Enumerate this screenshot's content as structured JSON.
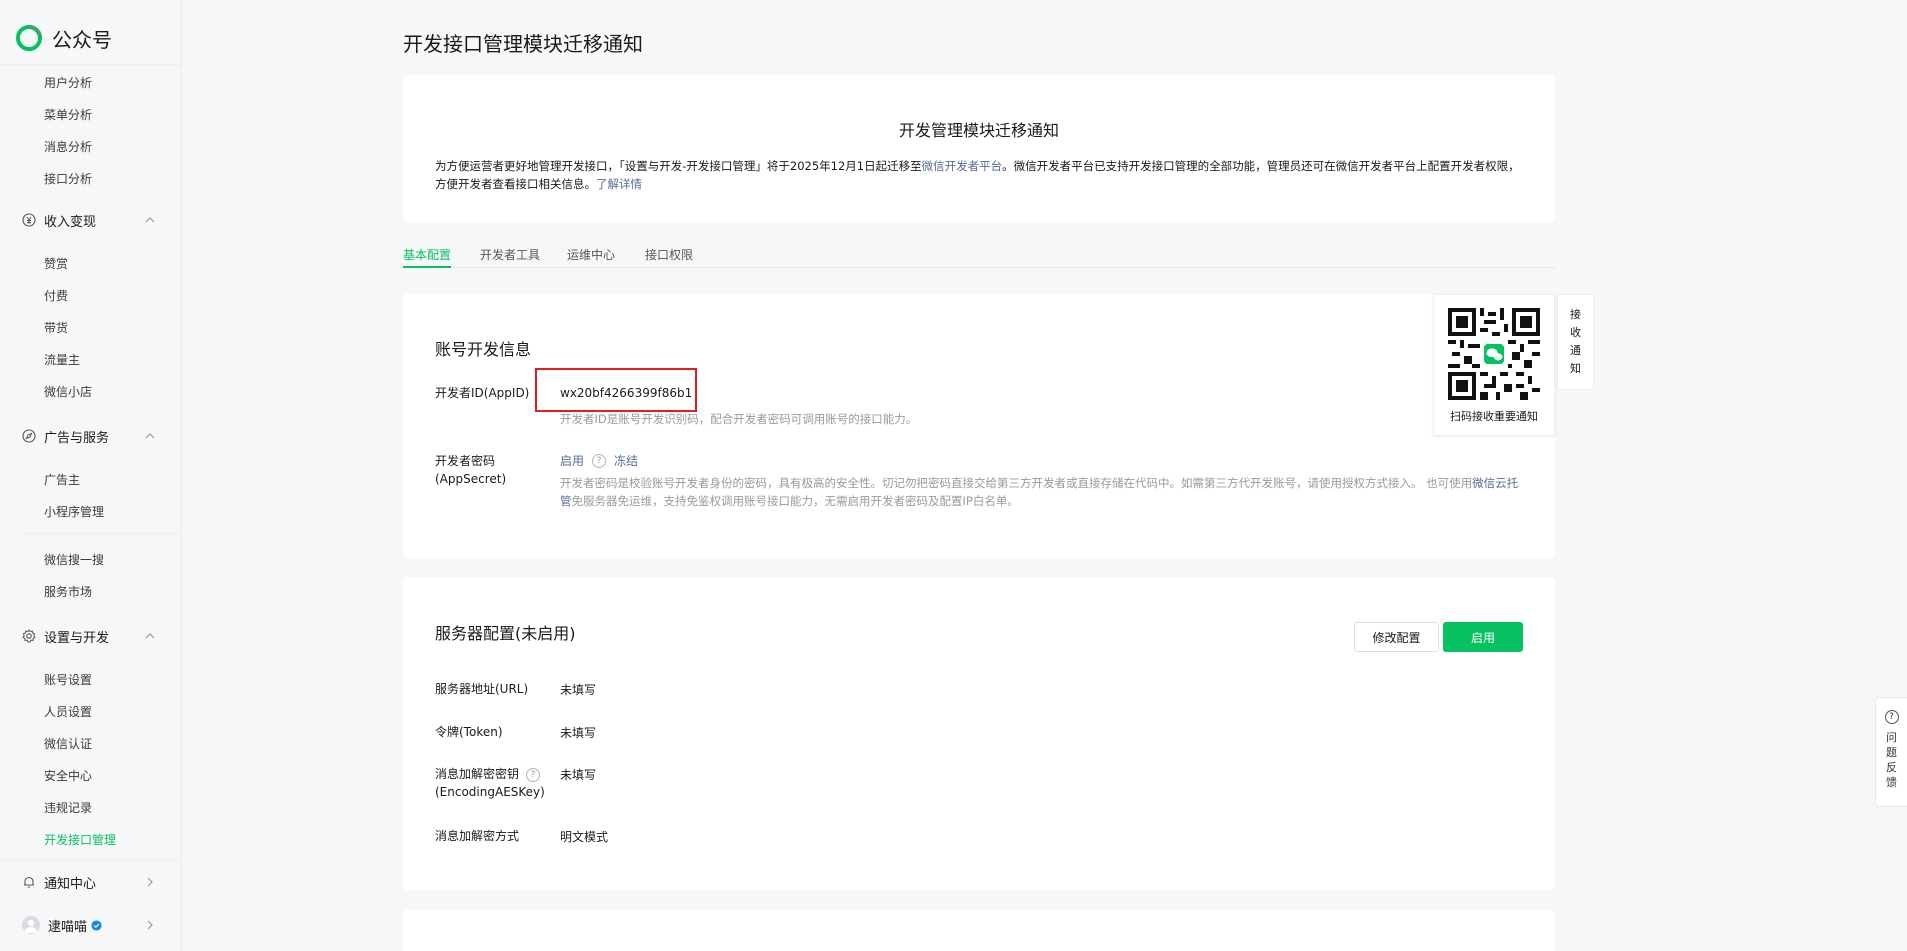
{
  "sidebar": {
    "logo_text": "公众号",
    "analytics_items": [
      "用户分析",
      "菜单分析",
      "消息分析",
      "接口分析"
    ],
    "monetize": {
      "label": "收入变现",
      "items": [
        "赞赏",
        "付费",
        "带货",
        "流量主",
        "微信小店"
      ]
    },
    "ads": {
      "label": "广告与服务",
      "items": [
        "广告主",
        "小程序管理"
      ]
    },
    "extra_items": [
      "微信搜一搜",
      "服务市场"
    ],
    "settings": {
      "label": "设置与开发",
      "items": [
        "账号设置",
        "人员设置",
        "微信认证",
        "安全中心",
        "违规记录",
        "开发接口管理"
      ]
    },
    "notify": {
      "label": "通知中心"
    },
    "account": {
      "name": "逮喵喵"
    }
  },
  "page_title": "开发接口管理模块迁移通知",
  "notice": {
    "title": "开发管理模块迁移通知",
    "body_1": "为方便运营者更好地管理开发接口，「设置与开发-开发接口管理」将于2025年12月1日起迁移至",
    "link_platform": "微信开发者平台",
    "body_2": "。微信开发者平台已支持开发接口管理的全部功能，管理员还可在微信开发者平台上配置开发者权限，方便开发者查看接口相关信息。",
    "link_more": "了解详情"
  },
  "tabs": [
    "基本配置",
    "开发者工具",
    "运维中心",
    "接口权限"
  ],
  "account_dev": {
    "title": "账号开发信息",
    "appid_label": "开发者ID(AppID)",
    "appid_value": "wx20bf4266399f86b1",
    "appid_desc": "开发者ID是账号开发识别码，配合开发者密码可调用账号的接口能力。",
    "secret_label": "开发者密码(AppSecret)",
    "secret_enable": "启用",
    "secret_freeze": "冻结",
    "secret_desc_1": "开发者密码是校验账号开发者身份的密码，具有极高的安全性。切记勿把密码直接交给第三方开发者或直接存储在代码中。如需第三方代开发账号，请使用授权方式接入。 也可使用",
    "secret_desc_link": "微信云托管",
    "secret_desc_2": "免服务器免运维，支持免鉴权调用账号接口能力，无需启用开发者密码及配置IP白名单。"
  },
  "qr": {
    "caption": "扫码接收重要通知",
    "side_tab": "接收通知"
  },
  "server": {
    "title": "服务器配置(未启用)",
    "modify_btn": "修改配置",
    "enable_btn": "启用",
    "rows": [
      {
        "label": "服务器地址(URL)",
        "value": "未填写"
      },
      {
        "label": "令牌(Token)",
        "value": "未填写"
      },
      {
        "label": "消息加解密密钥",
        "label_2": "(EncodingAESKey)",
        "value": "未填写"
      },
      {
        "label": "消息加解密方式",
        "value": "明文模式"
      }
    ]
  },
  "feedback": {
    "label": "问题反馈"
  },
  "colors": {
    "accent": "#07c160",
    "link": "#576b95",
    "highlight_box": "#e02020"
  }
}
